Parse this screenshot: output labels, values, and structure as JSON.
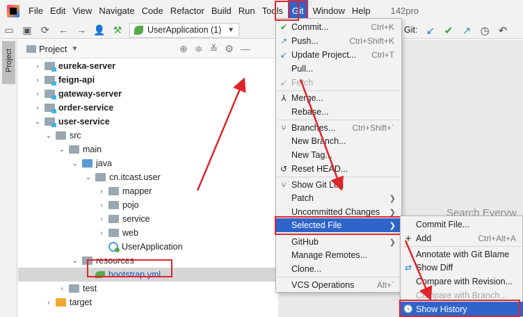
{
  "menubar": {
    "items": [
      "File",
      "Edit",
      "View",
      "Navigate",
      "Code",
      "Refactor",
      "Build",
      "Run",
      "Tools",
      "Git",
      "Window",
      "Help"
    ],
    "project_name": "142pro"
  },
  "toolbar": {
    "run_config": "UserApplication (1)",
    "git_label": "Git:"
  },
  "stripe": {
    "tab_label": "Project"
  },
  "project_panel": {
    "title": "Project",
    "tree": [
      {
        "label": "eureka-server",
        "bold": true
      },
      {
        "label": "feign-api",
        "bold": true
      },
      {
        "label": "gateway-server",
        "bold": true
      },
      {
        "label": "order-service",
        "bold": true
      },
      {
        "label": "user-service",
        "bold": true
      },
      {
        "label": "src"
      },
      {
        "label": "main"
      },
      {
        "label": "java"
      },
      {
        "label": "cn.itcast.user"
      },
      {
        "label": "mapper"
      },
      {
        "label": "pojo"
      },
      {
        "label": "service"
      },
      {
        "label": "web"
      },
      {
        "label": "UserApplication"
      },
      {
        "label": "resources"
      },
      {
        "label": "bootstrap.yml"
      },
      {
        "label": "test"
      },
      {
        "label": "target"
      }
    ]
  },
  "git_menu": {
    "items": [
      {
        "icon": "✔",
        "label": "Commit...",
        "shortcut": "Ctrl+K"
      },
      {
        "icon": "↗",
        "label": "Push...",
        "shortcut": "Ctrl+Shift+K"
      },
      {
        "icon": "↙",
        "label": "Update Project...",
        "shortcut": "Ctrl+T"
      },
      {
        "icon": "",
        "label": "Pull...",
        "shortcut": ""
      },
      {
        "icon": "↙",
        "label": "Fetch",
        "shortcut": "",
        "disabled": true
      },
      {
        "icon": "⅄",
        "label": "Merge...",
        "shortcut": ""
      },
      {
        "icon": "",
        "label": "Rebase...",
        "shortcut": ""
      },
      {
        "icon": "⑂",
        "label": "Branches...",
        "shortcut": "Ctrl+Shift+`"
      },
      {
        "icon": "",
        "label": "New Branch...",
        "shortcut": ""
      },
      {
        "icon": "",
        "label": "New Tag...",
        "shortcut": ""
      },
      {
        "icon": "↺",
        "label": "Reset HEAD...",
        "shortcut": ""
      },
      {
        "icon": "⑂",
        "label": "Show Git Log",
        "shortcut": ""
      },
      {
        "icon": "",
        "label": "Patch",
        "shortcut": "",
        "submenu": true
      },
      {
        "icon": "",
        "label": "Uncommitted Changes",
        "shortcut": "",
        "submenu": true
      },
      {
        "icon": "",
        "label": "Selected File",
        "shortcut": "",
        "submenu": true
      },
      {
        "icon": "",
        "label": "GitHub",
        "shortcut": "",
        "submenu": true
      },
      {
        "icon": "",
        "label": "Manage Remotes...",
        "shortcut": ""
      },
      {
        "icon": "",
        "label": "Clone...",
        "shortcut": ""
      },
      {
        "icon": "",
        "label": "VCS Operations",
        "shortcut": "Alt+`"
      }
    ]
  },
  "selected_file_submenu": {
    "items": [
      {
        "icon": "",
        "label": "Commit File...",
        "shortcut": ""
      },
      {
        "icon": "+",
        "label": "Add",
        "shortcut": "Ctrl+Alt+A"
      },
      {
        "icon": "",
        "label": "Annotate with Git Blame",
        "shortcut": ""
      },
      {
        "icon": "⇄",
        "label": "Show Diff",
        "shortcut": ""
      },
      {
        "icon": "",
        "label": "Compare with Revision...",
        "shortcut": ""
      },
      {
        "icon": "",
        "label": "Compare with Branch...",
        "shortcut": "",
        "disabled": true
      },
      {
        "icon": "🕓",
        "label": "Show History",
        "shortcut": ""
      }
    ]
  },
  "editor": {
    "search_hint": "Search Everyw"
  },
  "colors": {
    "accent": "#2f65ca",
    "annotation_red": "#e0242c"
  }
}
